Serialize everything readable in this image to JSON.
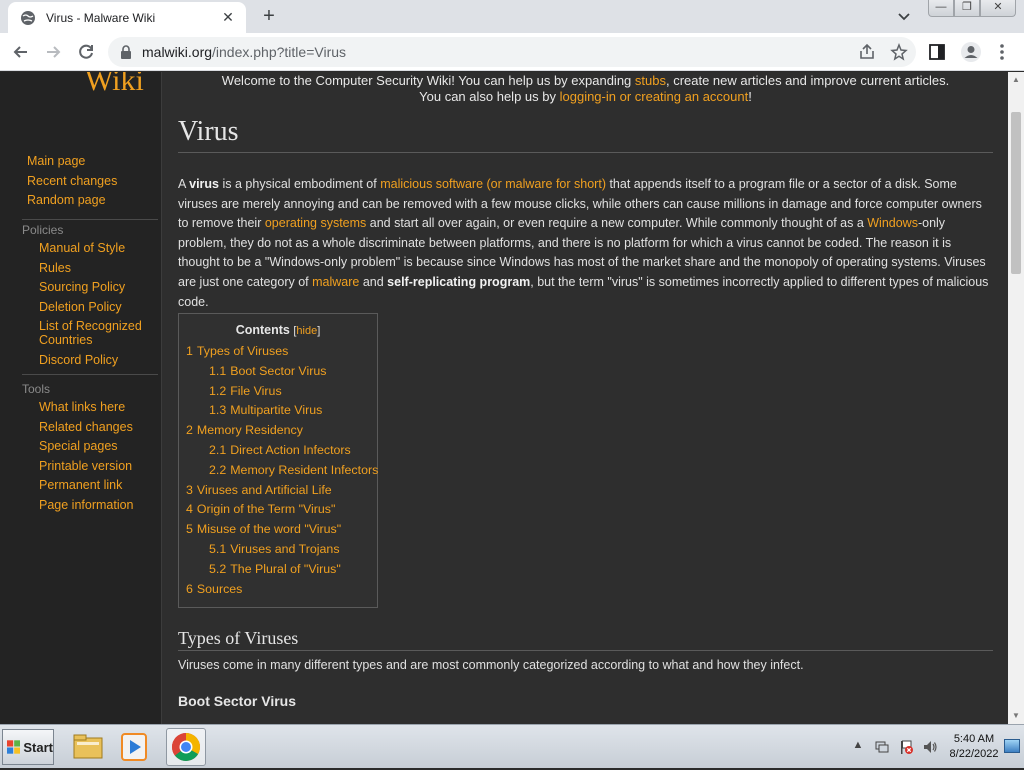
{
  "browser": {
    "tab_title": "Virus - Malware Wiki",
    "tab_close": "✕",
    "new_tab": "+",
    "url_host": "malwiki.org",
    "url_path": "/index.php?title=Virus"
  },
  "window_controls": {
    "minimize": "—",
    "restore": "❐",
    "close": "✕"
  },
  "sidebar": {
    "logo": "Wiki",
    "nav": [
      "Main page",
      "Recent changes",
      "Random page"
    ],
    "policies_heading": "Policies",
    "policies": [
      "Manual of Style",
      "Rules",
      "Sourcing Policy",
      "Deletion Policy",
      "List of Recognized Countries",
      "Discord Policy"
    ],
    "tools_heading": "Tools",
    "tools": [
      "What links here",
      "Related changes",
      "Special pages",
      "Printable version",
      "Permanent link",
      "Page information"
    ]
  },
  "notice": {
    "l1_a": "Welcome to the Computer Security Wiki! You can help us by expanding ",
    "l1_link": "stubs",
    "l1_b": ", create new articles and improve current articles.",
    "l2_a": "You can also help us by ",
    "l2_link": "logging-in or creating an account",
    "l2_b": "!"
  },
  "article": {
    "title": "Virus",
    "intro": {
      "t1": "A ",
      "b1": "virus",
      "t2": " is a physical embodiment of ",
      "l1": "malicious software (or malware for short)",
      "t3": " that appends itself to a program file or a sector of a disk. Some viruses are merely annoying and can be removed with a few mouse clicks, while others can cause millions in damage and force computer owners to remove their ",
      "l2": "operating systems",
      "t4": " and start all over again, or even require a new computer. While commonly thought of as a ",
      "l3": "Windows",
      "t5": "-only problem, they do not as a whole discriminate between platforms, and there is no platform for which a virus cannot be coded. The reason it is thought to be a \"Windows-only problem\" is because since Windows has most of the market share and the monopoly of operating systems. Viruses are just one category of ",
      "l4": "malware",
      "t6": " and ",
      "b2": "self-replicating program",
      "t7": ", but the term \"virus\" is sometimes incorrectly applied to different types of malicious code."
    },
    "toc": {
      "title": "Contents",
      "hide": "hide",
      "items": [
        {
          "num": "1",
          "label": "Types of Viruses",
          "sub": false
        },
        {
          "num": "1.1",
          "label": "Boot Sector Virus",
          "sub": true
        },
        {
          "num": "1.2",
          "label": "File Virus",
          "sub": true
        },
        {
          "num": "1.3",
          "label": "Multipartite Virus",
          "sub": true
        },
        {
          "num": "2",
          "label": "Memory Residency",
          "sub": false
        },
        {
          "num": "2.1",
          "label": "Direct Action Infectors",
          "sub": true
        },
        {
          "num": "2.2",
          "label": "Memory Resident Infectors",
          "sub": true
        },
        {
          "num": "3",
          "label": "Viruses and Artificial Life",
          "sub": false
        },
        {
          "num": "4",
          "label": "Origin of the Term \"Virus\"",
          "sub": false
        },
        {
          "num": "5",
          "label": "Misuse of the word \"Virus\"",
          "sub": false
        },
        {
          "num": "5.1",
          "label": "Viruses and Trojans",
          "sub": true
        },
        {
          "num": "5.2",
          "label": "The Plural of \"Virus\"",
          "sub": true
        },
        {
          "num": "6",
          "label": "Sources",
          "sub": false
        }
      ]
    },
    "section1_title": "Types of Viruses",
    "section1_text": "Viruses come in many different types and are most commonly categorized according to what and how they infect.",
    "section1_1_title": "Boot Sector Virus"
  },
  "taskbar": {
    "start": "Start",
    "time": "5:40 AM",
    "date": "8/22/2022"
  }
}
